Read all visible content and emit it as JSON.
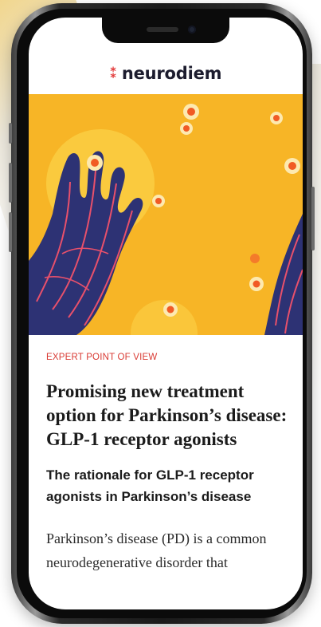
{
  "header": {
    "logo_mark": "⁑",
    "brand": "neurodiem"
  },
  "hero": {
    "image": "hand-illustration",
    "colors": {
      "background": "#f7b526",
      "hand": "#2d3274",
      "veins": "#e8506b",
      "cells": "#f15a24"
    }
  },
  "article": {
    "category": "EXPERT POINT OF VIEW",
    "title": "Promising new treatment option for Parkinson’s disease: GLP-1 receptor agonists",
    "subtitle": "The rationale for GLP-1 receptor agonists in Parkinson’s disease",
    "body": "Parkinson’s disease (PD) is a common neurodegenerative disorder that"
  },
  "colors": {
    "accent": "#e23b3b",
    "category": "#d93a33",
    "text": "#1b1b1b"
  }
}
